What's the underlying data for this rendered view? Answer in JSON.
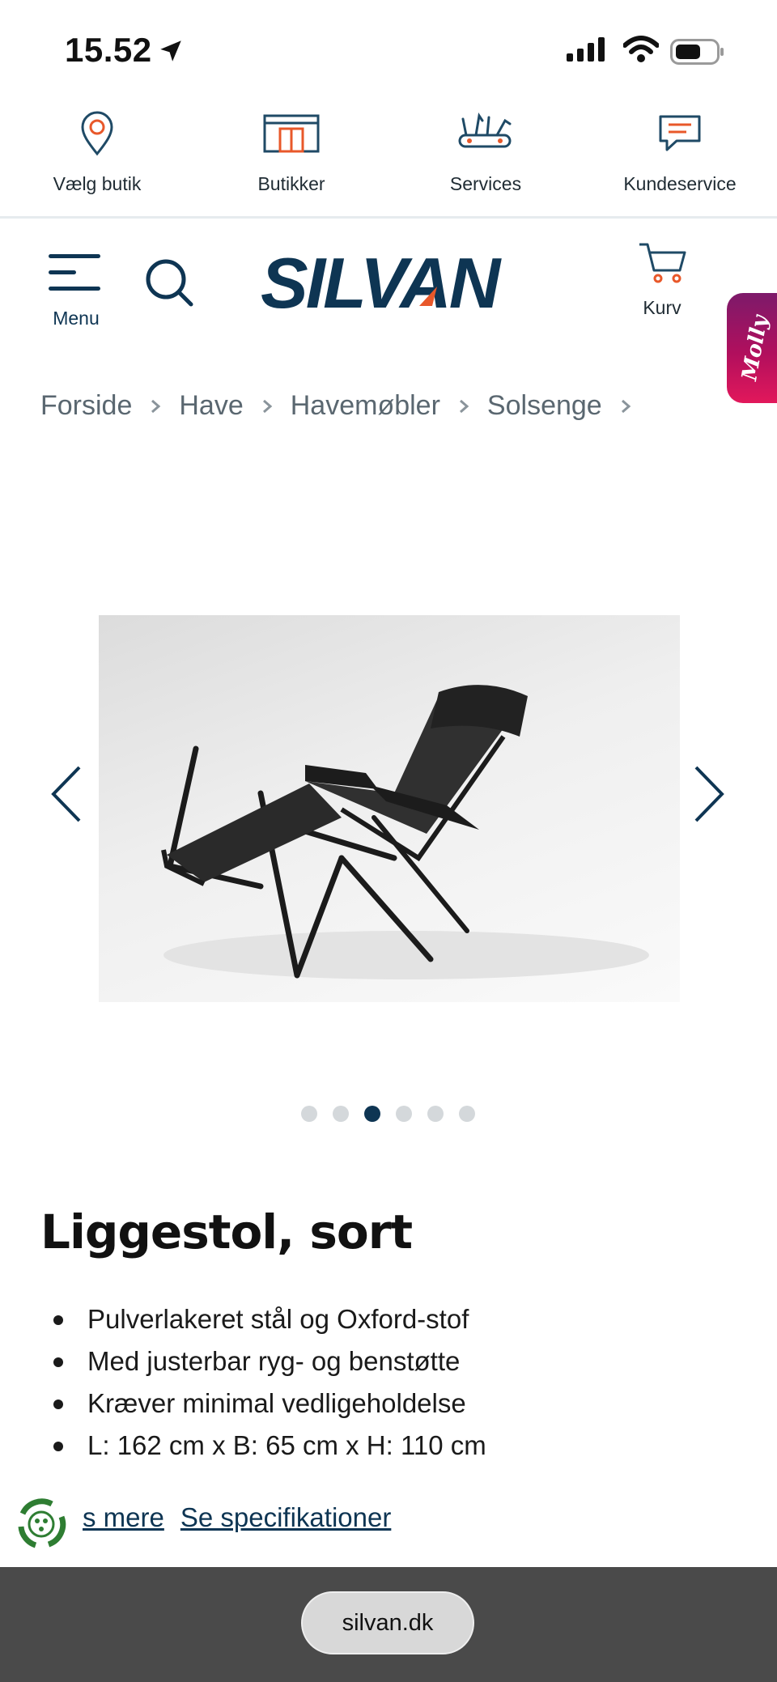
{
  "status_bar": {
    "time": "15.52"
  },
  "utility_nav": [
    {
      "id": "choose-store",
      "label": "Vælg butik",
      "icon": "location-pin-icon"
    },
    {
      "id": "stores",
      "label": "Butikker",
      "icon": "store-icon"
    },
    {
      "id": "services",
      "label": "Services",
      "icon": "tools-icon"
    },
    {
      "id": "customer-service",
      "label": "Kundeservice",
      "icon": "chat-icon"
    }
  ],
  "header": {
    "menu_label": "Menu",
    "logo_text": "SILVAN",
    "cart_label": "Kurv",
    "chat_widget_label": "Molly"
  },
  "breadcrumb": [
    "Forside",
    "Have",
    "Havemøbler",
    "Solsenge"
  ],
  "gallery": {
    "image_count": 6,
    "active_index": 2
  },
  "product": {
    "title": "Liggestol, sort",
    "features": [
      "Pulverlakeret stål og Oxford-stof",
      "Med justerbar ryg- og benstøtte",
      "Kræver minimal vedligeholdelse",
      "L: 162 cm x B: 65 cm x H: 110 cm"
    ],
    "read_more": "s mere",
    "see_specs": "Se specifikationer"
  },
  "browser": {
    "url": "silvan.dk"
  },
  "colors": {
    "brand_navy": "#0e3553",
    "brand_orange": "#e8582a",
    "molly_magenta": "#b10f5d"
  }
}
